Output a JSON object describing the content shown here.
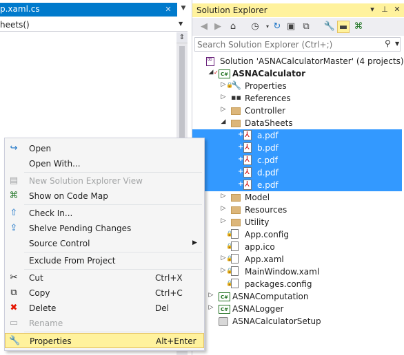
{
  "editor": {
    "tab_title": "p.xaml.cs",
    "tab_close": "✕",
    "nav_member": "heets()"
  },
  "solution_explorer": {
    "title": "Solution Explorer",
    "search_placeholder": "Search Solution Explorer (Ctrl+;)",
    "tree": [
      {
        "label": "Solution 'ASNACalculatorMaster' (4 projects)",
        "icon": "solution-icon",
        "indent": 0,
        "expander": "",
        "selected": false,
        "bold": false,
        "marker": ""
      },
      {
        "label": "ASNACalculator",
        "icon": "csharp-project-icon",
        "indent": 1,
        "expander": "◢",
        "selected": false,
        "bold": true,
        "marker": "✓"
      },
      {
        "label": "Properties",
        "icon": "wrench-icon",
        "indent": 2,
        "expander": "▷",
        "selected": false,
        "bold": false,
        "marker": "lock"
      },
      {
        "label": "References",
        "icon": "references-icon",
        "indent": 2,
        "expander": "▷",
        "selected": false,
        "bold": false,
        "marker": ""
      },
      {
        "label": "Controller",
        "icon": "folder-icon",
        "indent": 2,
        "expander": "▷",
        "selected": false,
        "bold": false,
        "marker": ""
      },
      {
        "label": "DataSheets",
        "icon": "folder-icon",
        "indent": 2,
        "expander": "◢",
        "selected": false,
        "bold": false,
        "marker": ""
      },
      {
        "label": "a.pdf",
        "icon": "pdf-icon",
        "indent": 3,
        "expander": "",
        "selected": true,
        "bold": false,
        "marker": "+"
      },
      {
        "label": "b.pdf",
        "icon": "pdf-icon",
        "indent": 3,
        "expander": "",
        "selected": true,
        "bold": false,
        "marker": "+"
      },
      {
        "label": "c.pdf",
        "icon": "pdf-icon",
        "indent": 3,
        "expander": "",
        "selected": true,
        "bold": false,
        "marker": "+"
      },
      {
        "label": "d.pdf",
        "icon": "pdf-icon",
        "indent": 3,
        "expander": "",
        "selected": true,
        "bold": false,
        "marker": "+"
      },
      {
        "label": "e.pdf",
        "icon": "pdf-icon",
        "indent": 3,
        "expander": "",
        "selected": true,
        "bold": false,
        "marker": "+"
      },
      {
        "label": "Model",
        "icon": "folder-icon",
        "indent": 2,
        "expander": "▷",
        "selected": false,
        "bold": false,
        "marker": ""
      },
      {
        "label": "Resources",
        "icon": "folder-icon",
        "indent": 2,
        "expander": "▷",
        "selected": false,
        "bold": false,
        "marker": ""
      },
      {
        "label": "Utility",
        "icon": "folder-icon",
        "indent": 2,
        "expander": "▷",
        "selected": false,
        "bold": false,
        "marker": ""
      },
      {
        "label": "App.config",
        "icon": "file-icon",
        "indent": 2,
        "expander": "",
        "selected": false,
        "bold": false,
        "marker": "lock"
      },
      {
        "label": "app.ico",
        "icon": "file-icon",
        "indent": 2,
        "expander": "",
        "selected": false,
        "bold": false,
        "marker": "lock"
      },
      {
        "label": "App.xaml",
        "icon": "file-icon",
        "indent": 2,
        "expander": "▷",
        "selected": false,
        "bold": false,
        "marker": "lock"
      },
      {
        "label": "MainWindow.xaml",
        "icon": "file-icon",
        "indent": 2,
        "expander": "▷",
        "selected": false,
        "bold": false,
        "marker": "lock"
      },
      {
        "label": "packages.config",
        "icon": "file-icon",
        "indent": 2,
        "expander": "",
        "selected": false,
        "bold": false,
        "marker": "lock"
      },
      {
        "label": "ASNAComputation",
        "icon": "csharp-project-icon",
        "indent": 1,
        "expander": "▷",
        "selected": false,
        "bold": false,
        "marker": ""
      },
      {
        "label": "ASNALogger",
        "icon": "csharp-project-icon",
        "indent": 1,
        "expander": "▷",
        "selected": false,
        "bold": false,
        "marker": ""
      },
      {
        "label": "ASNACalculatorSetup",
        "icon": "setup-project-icon",
        "indent": 1,
        "expander": "",
        "selected": false,
        "bold": false,
        "marker": ""
      }
    ]
  },
  "context_menu": {
    "items": [
      {
        "label": "Open",
        "key": "",
        "icon": "open-icon",
        "glyph": "↪",
        "disabled": false,
        "highlight": false,
        "submenu": false
      },
      {
        "label": "Open With...",
        "key": "",
        "icon": "",
        "glyph": "",
        "disabled": false,
        "highlight": false,
        "submenu": false
      },
      {
        "sep": true
      },
      {
        "label": "New Solution Explorer View",
        "key": "",
        "icon": "new-view-icon",
        "glyph": "▤",
        "disabled": true,
        "highlight": false,
        "submenu": false
      },
      {
        "label": "Show on Code Map",
        "key": "",
        "icon": "code-map-icon",
        "glyph": "⌘",
        "disabled": false,
        "highlight": false,
        "submenu": false
      },
      {
        "sep": true
      },
      {
        "label": "Check In...",
        "key": "",
        "icon": "check-in-icon",
        "glyph": "⇧",
        "disabled": false,
        "highlight": false,
        "submenu": false
      },
      {
        "label": "Shelve Pending Changes",
        "key": "",
        "icon": "shelve-icon",
        "glyph": "⇪",
        "disabled": false,
        "highlight": false,
        "submenu": false
      },
      {
        "label": "Source Control",
        "key": "",
        "icon": "",
        "glyph": "",
        "disabled": false,
        "highlight": false,
        "submenu": true
      },
      {
        "sep": true
      },
      {
        "label": "Exclude From Project",
        "key": "",
        "icon": "",
        "glyph": "",
        "disabled": false,
        "highlight": false,
        "submenu": false
      },
      {
        "sep": true
      },
      {
        "label": "Cut",
        "key": "Ctrl+X",
        "icon": "cut-icon",
        "glyph": "✂",
        "disabled": false,
        "highlight": false,
        "submenu": false
      },
      {
        "label": "Copy",
        "key": "Ctrl+C",
        "icon": "copy-icon",
        "glyph": "⧉",
        "disabled": false,
        "highlight": false,
        "submenu": false
      },
      {
        "label": "Delete",
        "key": "Del",
        "icon": "delete-icon",
        "glyph": "✖",
        "disabled": false,
        "highlight": false,
        "submenu": false
      },
      {
        "label": "Rename",
        "key": "",
        "icon": "rename-icon",
        "glyph": "▭",
        "disabled": true,
        "highlight": false,
        "submenu": false
      },
      {
        "sep": true
      },
      {
        "label": "Properties",
        "key": "Alt+Enter",
        "icon": "properties-wrench-icon",
        "glyph": "🔧",
        "disabled": false,
        "highlight": true,
        "submenu": false
      }
    ]
  },
  "colors": {
    "accent": "#007acc",
    "selection": "#3399ff",
    "highlight": "#fff29d",
    "delete_red": "#e51400"
  }
}
